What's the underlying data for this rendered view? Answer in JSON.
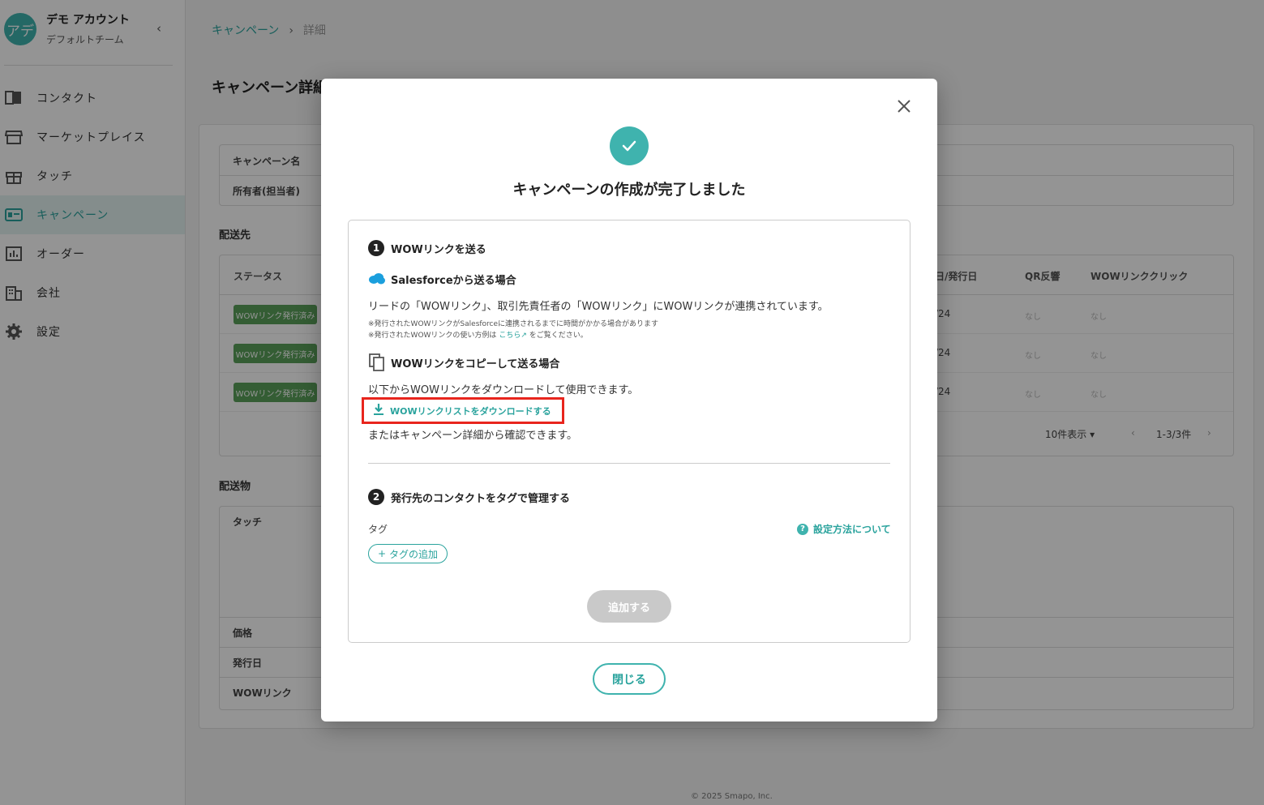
{
  "account": {
    "avatar_text": "アデ",
    "name": "デモ アカウント",
    "team": "デフォルトチーム",
    "collapse_icon": "chevron-left-icon"
  },
  "sidebar": {
    "items": [
      {
        "label": "コンタクト",
        "icon": "contacts-book-icon",
        "active": false
      },
      {
        "label": "マーケットプレイス",
        "icon": "store-icon",
        "active": false
      },
      {
        "label": "タッチ",
        "icon": "gift-icon",
        "active": false
      },
      {
        "label": "キャンペーン",
        "icon": "campaign-icon",
        "active": true
      },
      {
        "label": "オーダー",
        "icon": "chart-icon",
        "active": false
      },
      {
        "label": "会社",
        "icon": "building-icon",
        "active": false
      },
      {
        "label": "設定",
        "icon": "gear-icon",
        "active": false
      }
    ]
  },
  "breadcrumb": {
    "first": "キャンペーン",
    "separator": "›",
    "current": "詳細"
  },
  "page_title": "キャンペーン詳細",
  "campaign_info": {
    "name_label": "キャンペーン名",
    "owner_label": "所有者(担当者)"
  },
  "shipping": {
    "section_label": "配送先",
    "columns": {
      "status": "ステータス",
      "date": "日/発行日",
      "qr": "QR反響",
      "click": "WOWリンククリック"
    },
    "rows": [
      {
        "status": "WOWリンク発行済み",
        "date": "/24",
        "qr": "なし",
        "click": "なし"
      },
      {
        "status": "WOWリンク発行済み",
        "date": "/24",
        "qr": "なし",
        "click": "なし"
      },
      {
        "status": "WOWリンク発行済み",
        "date": "/24",
        "qr": "なし",
        "click": "なし"
      }
    ],
    "per_page": "10件表示",
    "range": "1-3/3件"
  },
  "items": {
    "section_label": "配送物",
    "touch_label": "タッチ",
    "price_label": "価格",
    "issue_date_label": "発行日",
    "wow_link_label": "WOWリンク"
  },
  "footer": {
    "copyright": "© 2025 Smapo, Inc."
  },
  "modal": {
    "title": "キャンペーンの作成が完了しました",
    "step1": {
      "num": "1",
      "title": "WOWリンクを送る"
    },
    "salesforce": {
      "title": "Salesforceから送る場合",
      "desc": "リードの「WOWリンク」、取引先責任者の「WOWリンク」にWOWリンクが連携されています。",
      "note1": "※発行されたWOWリンクがSalesforceに連携されるまでに時間がかかる場合があります",
      "note2_pre": "※発行されたWOWリンクの使い方例は",
      "note2_link": "こちら",
      "note2_post": "をご覧ください。"
    },
    "copy": {
      "title": "WOWリンクをコピーして送る場合",
      "desc": "以下からWOWリンクをダウンロードして使用できます。",
      "download_label": "WOWリンクリストをダウンロードする",
      "alt_text": "またはキャンペーン詳細から確認できます。"
    },
    "step2": {
      "num": "2",
      "title": "発行先のコンタクトをタグで管理する"
    },
    "tag_label": "タグ",
    "help_label": "設定方法について",
    "tag_add_label": "タグの追加",
    "add_button": "追加する",
    "close_button": "閉じる"
  },
  "colors": {
    "accent": "#3fb3ae",
    "highlight": "#e8251d",
    "badge": "#5aa05a"
  }
}
